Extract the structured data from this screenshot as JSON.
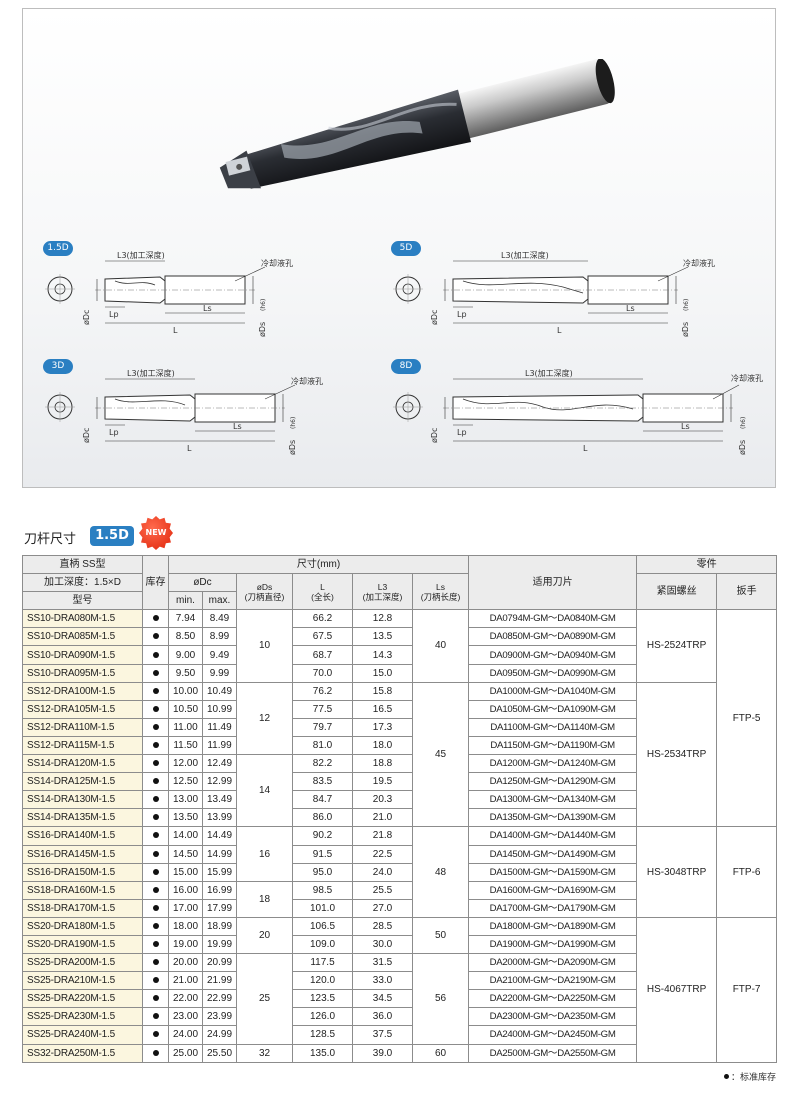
{
  "colors": {
    "accent": "#2a7fc2",
    "new_badge": "#e8381c",
    "model_cell_bg": "#fbf6df",
    "header_bg": "#ececec"
  },
  "diagrams": [
    {
      "tag": "1.5D",
      "l3_label": "L3(加工深度)",
      "coolant_label": "冷却液孔",
      "dc_label": "øDc",
      "lp_label": "Lp",
      "ls_label": "Ls",
      "l_label": "L",
      "ds_label": "øDs",
      "ds_tol": "(h6)"
    },
    {
      "tag": "5D",
      "l3_label": "L3(加工深度)",
      "coolant_label": "冷却液孔",
      "dc_label": "øDc",
      "lp_label": "Lp",
      "ls_label": "Ls",
      "l_label": "L",
      "ds_label": "øDs",
      "ds_tol": "(h6)"
    },
    {
      "tag": "3D",
      "l3_label": "L3(加工深度)",
      "coolant_label": "冷却液孔",
      "dc_label": "øDc",
      "lp_label": "Lp",
      "ls_label": "Ls",
      "l_label": "L",
      "ds_label": "øDs",
      "ds_tol": "(h6)"
    },
    {
      "tag": "8D",
      "l3_label": "L3(加工深度)",
      "coolant_label": "冷却液孔",
      "dc_label": "øDc",
      "lp_label": "Lp",
      "ls_label": "Ls",
      "l_label": "L",
      "ds_label": "øDs",
      "ds_tol": "(h6)"
    }
  ],
  "section": {
    "title": "刀杆尺寸",
    "badge": "1.5D",
    "new_badge": "NEW"
  },
  "table": {
    "header": {
      "shank": "直柄 SS型",
      "depth": "加工深度：1.5×D",
      "model": "型号",
      "stock": "库存",
      "dimensions": "尺寸(mm)",
      "dc": "øDc",
      "dc_min": "min.",
      "dc_max": "max.",
      "ds": "øDs",
      "ds_sub": "(刀柄直径)",
      "l": "L",
      "l_sub": "(全长)",
      "l3": "L3",
      "l3_sub": "(加工深度)",
      "ls": "Ls",
      "ls_sub": "(刀柄长度)",
      "insert": "适用刀片",
      "parts": "零件",
      "screw": "紧固螺丝",
      "wrench": "扳手"
    },
    "rows": [
      {
        "model": "SS10-DRA080M-1.5",
        "min": "7.94",
        "max": "8.49",
        "l": "66.2",
        "l3": "12.8",
        "insert": "DA0794M-GM～DA0840M-GM"
      },
      {
        "model": "SS10-DRA085M-1.5",
        "min": "8.50",
        "max": "8.99",
        "l": "67.5",
        "l3": "13.5",
        "insert": "DA0850M-GM～DA0890M-GM"
      },
      {
        "model": "SS10-DRA090M-1.5",
        "min": "9.00",
        "max": "9.49",
        "l": "68.7",
        "l3": "14.3",
        "insert": "DA0900M-GM～DA0940M-GM"
      },
      {
        "model": "SS10-DRA095M-1.5",
        "min": "9.50",
        "max": "9.99",
        "l": "70.0",
        "l3": "15.0",
        "insert": "DA0950M-GM～DA0990M-GM"
      },
      {
        "model": "SS12-DRA100M-1.5",
        "min": "10.00",
        "max": "10.49",
        "l": "76.2",
        "l3": "15.8",
        "insert": "DA1000M-GM～DA1040M-GM"
      },
      {
        "model": "SS12-DRA105M-1.5",
        "min": "10.50",
        "max": "10.99",
        "l": "77.5",
        "l3": "16.5",
        "insert": "DA1050M-GM～DA1090M-GM"
      },
      {
        "model": "SS12-DRA110M-1.5",
        "min": "11.00",
        "max": "11.49",
        "l": "79.7",
        "l3": "17.3",
        "insert": "DA1100M-GM～DA1140M-GM"
      },
      {
        "model": "SS12-DRA115M-1.5",
        "min": "11.50",
        "max": "11.99",
        "l": "81.0",
        "l3": "18.0",
        "insert": "DA1150M-GM～DA1190M-GM"
      },
      {
        "model": "SS14-DRA120M-1.5",
        "min": "12.00",
        "max": "12.49",
        "l": "82.2",
        "l3": "18.8",
        "insert": "DA1200M-GM～DA1240M-GM"
      },
      {
        "model": "SS14-DRA125M-1.5",
        "min": "12.50",
        "max": "12.99",
        "l": "83.5",
        "l3": "19.5",
        "insert": "DA1250M-GM～DA1290M-GM"
      },
      {
        "model": "SS14-DRA130M-1.5",
        "min": "13.00",
        "max": "13.49",
        "l": "84.7",
        "l3": "20.3",
        "insert": "DA1300M-GM～DA1340M-GM"
      },
      {
        "model": "SS14-DRA135M-1.5",
        "min": "13.50",
        "max": "13.99",
        "l": "86.0",
        "l3": "21.0",
        "insert": "DA1350M-GM～DA1390M-GM"
      },
      {
        "model": "SS16-DRA140M-1.5",
        "min": "14.00",
        "max": "14.49",
        "l": "90.2",
        "l3": "21.8",
        "insert": "DA1400M-GM～DA1440M-GM"
      },
      {
        "model": "SS16-DRA145M-1.5",
        "min": "14.50",
        "max": "14.99",
        "l": "91.5",
        "l3": "22.5",
        "insert": "DA1450M-GM～DA1490M-GM"
      },
      {
        "model": "SS16-DRA150M-1.5",
        "min": "15.00",
        "max": "15.99",
        "l": "95.0",
        "l3": "24.0",
        "insert": "DA1500M-GM～DA1590M-GM"
      },
      {
        "model": "SS18-DRA160M-1.5",
        "min": "16.00",
        "max": "16.99",
        "l": "98.5",
        "l3": "25.5",
        "insert": "DA1600M-GM～DA1690M-GM"
      },
      {
        "model": "SS18-DRA170M-1.5",
        "min": "17.00",
        "max": "17.99",
        "l": "101.0",
        "l3": "27.0",
        "insert": "DA1700M-GM～DA1790M-GM"
      },
      {
        "model": "SS20-DRA180M-1.5",
        "min": "18.00",
        "max": "18.99",
        "l": "106.5",
        "l3": "28.5",
        "insert": "DA1800M-GM～DA1890M-GM"
      },
      {
        "model": "SS20-DRA190M-1.5",
        "min": "19.00",
        "max": "19.99",
        "l": "109.0",
        "l3": "30.0",
        "insert": "DA1900M-GM～DA1990M-GM"
      },
      {
        "model": "SS25-DRA200M-1.5",
        "min": "20.00",
        "max": "20.99",
        "l": "117.5",
        "l3": "31.5",
        "insert": "DA2000M-GM～DA2090M-GM"
      },
      {
        "model": "SS25-DRA210M-1.5",
        "min": "21.00",
        "max": "21.99",
        "l": "120.0",
        "l3": "33.0",
        "insert": "DA2100M-GM～DA2190M-GM"
      },
      {
        "model": "SS25-DRA220M-1.5",
        "min": "22.00",
        "max": "22.99",
        "l": "123.5",
        "l3": "34.5",
        "insert": "DA2200M-GM～DA2250M-GM"
      },
      {
        "model": "SS25-DRA230M-1.5",
        "min": "23.00",
        "max": "23.99",
        "l": "126.0",
        "l3": "36.0",
        "insert": "DA2300M-GM～DA2350M-GM"
      },
      {
        "model": "SS25-DRA240M-1.5",
        "min": "24.00",
        "max": "24.99",
        "l": "128.5",
        "l3": "37.5",
        "insert": "DA2400M-GM～DA2450M-GM"
      },
      {
        "model": "SS32-DRA250M-1.5",
        "min": "25.00",
        "max": "25.50",
        "l": "135.0",
        "l3": "39.0",
        "insert": "DA2500M-GM～DA2550M-GM"
      }
    ],
    "ds_groups": [
      {
        "value": "10",
        "span": 4
      },
      {
        "value": "12",
        "span": 4
      },
      {
        "value": "14",
        "span": 4
      },
      {
        "value": "16",
        "span": 3
      },
      {
        "value": "18",
        "span": 2
      },
      {
        "value": "20",
        "span": 2
      },
      {
        "value": "25",
        "span": 5
      },
      {
        "value": "32",
        "span": 1
      }
    ],
    "ls_groups": [
      {
        "value": "40",
        "span": 4
      },
      {
        "value": "45",
        "span": 8
      },
      {
        "value": "48",
        "span": 5
      },
      {
        "value": "50",
        "span": 2
      },
      {
        "value": "56",
        "span": 5
      },
      {
        "value": "60",
        "span": 1
      }
    ],
    "screw_groups": [
      {
        "value": "HS-2524TRP",
        "span": 4
      },
      {
        "value": "HS-2534TRP",
        "span": 8
      },
      {
        "value": "HS-3048TRP",
        "span": 5
      },
      {
        "value": "HS-4067TRP",
        "span": 8
      }
    ],
    "wrench_groups": [
      {
        "value": "FTP-5",
        "span": 12
      },
      {
        "value": "FTP-6",
        "span": 5
      },
      {
        "value": "FTP-7",
        "span": 8
      }
    ]
  },
  "legend": {
    "symbol": "●",
    "text": "：标准库存"
  }
}
